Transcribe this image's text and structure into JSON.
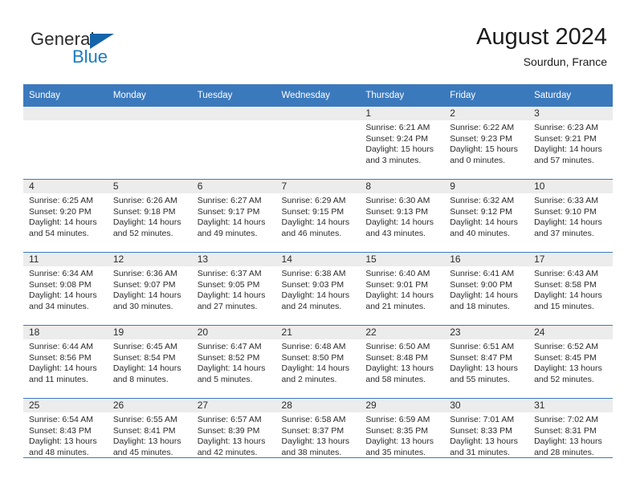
{
  "brand": {
    "name_part1": "General",
    "name_part2": "Blue",
    "triangle_icon": "blue-triangle-icon",
    "accent_color": "#1a7cc4"
  },
  "header": {
    "title": "August 2024",
    "subtitle": "Sourdun, France"
  },
  "theme": {
    "header_blue": "#3b79bd",
    "daynum_band": "#ececec",
    "text": "#2b2b2b"
  },
  "weekdays": [
    "Sunday",
    "Monday",
    "Tuesday",
    "Wednesday",
    "Thursday",
    "Friday",
    "Saturday"
  ],
  "labels": {
    "sunrise": "Sunrise:",
    "sunset": "Sunset:",
    "daylight": "Daylight:"
  },
  "weeks": [
    [
      {
        "blank": true
      },
      {
        "blank": true
      },
      {
        "blank": true
      },
      {
        "blank": true
      },
      {
        "day": "1",
        "sunrise": "Sunrise: 6:21 AM",
        "sunset": "Sunset: 9:24 PM",
        "daylight_line1": "Daylight: 15 hours",
        "daylight_line2": "and 3 minutes."
      },
      {
        "day": "2",
        "sunrise": "Sunrise: 6:22 AM",
        "sunset": "Sunset: 9:23 PM",
        "daylight_line1": "Daylight: 15 hours",
        "daylight_line2": "and 0 minutes."
      },
      {
        "day": "3",
        "sunrise": "Sunrise: 6:23 AM",
        "sunset": "Sunset: 9:21 PM",
        "daylight_line1": "Daylight: 14 hours",
        "daylight_line2": "and 57 minutes."
      }
    ],
    [
      {
        "day": "4",
        "sunrise": "Sunrise: 6:25 AM",
        "sunset": "Sunset: 9:20 PM",
        "daylight_line1": "Daylight: 14 hours",
        "daylight_line2": "and 54 minutes."
      },
      {
        "day": "5",
        "sunrise": "Sunrise: 6:26 AM",
        "sunset": "Sunset: 9:18 PM",
        "daylight_line1": "Daylight: 14 hours",
        "daylight_line2": "and 52 minutes."
      },
      {
        "day": "6",
        "sunrise": "Sunrise: 6:27 AM",
        "sunset": "Sunset: 9:17 PM",
        "daylight_line1": "Daylight: 14 hours",
        "daylight_line2": "and 49 minutes."
      },
      {
        "day": "7",
        "sunrise": "Sunrise: 6:29 AM",
        "sunset": "Sunset: 9:15 PM",
        "daylight_line1": "Daylight: 14 hours",
        "daylight_line2": "and 46 minutes."
      },
      {
        "day": "8",
        "sunrise": "Sunrise: 6:30 AM",
        "sunset": "Sunset: 9:13 PM",
        "daylight_line1": "Daylight: 14 hours",
        "daylight_line2": "and 43 minutes."
      },
      {
        "day": "9",
        "sunrise": "Sunrise: 6:32 AM",
        "sunset": "Sunset: 9:12 PM",
        "daylight_line1": "Daylight: 14 hours",
        "daylight_line2": "and 40 minutes."
      },
      {
        "day": "10",
        "sunrise": "Sunrise: 6:33 AM",
        "sunset": "Sunset: 9:10 PM",
        "daylight_line1": "Daylight: 14 hours",
        "daylight_line2": "and 37 minutes."
      }
    ],
    [
      {
        "day": "11",
        "sunrise": "Sunrise: 6:34 AM",
        "sunset": "Sunset: 9:08 PM",
        "daylight_line1": "Daylight: 14 hours",
        "daylight_line2": "and 34 minutes."
      },
      {
        "day": "12",
        "sunrise": "Sunrise: 6:36 AM",
        "sunset": "Sunset: 9:07 PM",
        "daylight_line1": "Daylight: 14 hours",
        "daylight_line2": "and 30 minutes."
      },
      {
        "day": "13",
        "sunrise": "Sunrise: 6:37 AM",
        "sunset": "Sunset: 9:05 PM",
        "daylight_line1": "Daylight: 14 hours",
        "daylight_line2": "and 27 minutes."
      },
      {
        "day": "14",
        "sunrise": "Sunrise: 6:38 AM",
        "sunset": "Sunset: 9:03 PM",
        "daylight_line1": "Daylight: 14 hours",
        "daylight_line2": "and 24 minutes."
      },
      {
        "day": "15",
        "sunrise": "Sunrise: 6:40 AM",
        "sunset": "Sunset: 9:01 PM",
        "daylight_line1": "Daylight: 14 hours",
        "daylight_line2": "and 21 minutes."
      },
      {
        "day": "16",
        "sunrise": "Sunrise: 6:41 AM",
        "sunset": "Sunset: 9:00 PM",
        "daylight_line1": "Daylight: 14 hours",
        "daylight_line2": "and 18 minutes."
      },
      {
        "day": "17",
        "sunrise": "Sunrise: 6:43 AM",
        "sunset": "Sunset: 8:58 PM",
        "daylight_line1": "Daylight: 14 hours",
        "daylight_line2": "and 15 minutes."
      }
    ],
    [
      {
        "day": "18",
        "sunrise": "Sunrise: 6:44 AM",
        "sunset": "Sunset: 8:56 PM",
        "daylight_line1": "Daylight: 14 hours",
        "daylight_line2": "and 11 minutes."
      },
      {
        "day": "19",
        "sunrise": "Sunrise: 6:45 AM",
        "sunset": "Sunset: 8:54 PM",
        "daylight_line1": "Daylight: 14 hours",
        "daylight_line2": "and 8 minutes."
      },
      {
        "day": "20",
        "sunrise": "Sunrise: 6:47 AM",
        "sunset": "Sunset: 8:52 PM",
        "daylight_line1": "Daylight: 14 hours",
        "daylight_line2": "and 5 minutes."
      },
      {
        "day": "21",
        "sunrise": "Sunrise: 6:48 AM",
        "sunset": "Sunset: 8:50 PM",
        "daylight_line1": "Daylight: 14 hours",
        "daylight_line2": "and 2 minutes."
      },
      {
        "day": "22",
        "sunrise": "Sunrise: 6:50 AM",
        "sunset": "Sunset: 8:48 PM",
        "daylight_line1": "Daylight: 13 hours",
        "daylight_line2": "and 58 minutes."
      },
      {
        "day": "23",
        "sunrise": "Sunrise: 6:51 AM",
        "sunset": "Sunset: 8:47 PM",
        "daylight_line1": "Daylight: 13 hours",
        "daylight_line2": "and 55 minutes."
      },
      {
        "day": "24",
        "sunrise": "Sunrise: 6:52 AM",
        "sunset": "Sunset: 8:45 PM",
        "daylight_line1": "Daylight: 13 hours",
        "daylight_line2": "and 52 minutes."
      }
    ],
    [
      {
        "day": "25",
        "sunrise": "Sunrise: 6:54 AM",
        "sunset": "Sunset: 8:43 PM",
        "daylight_line1": "Daylight: 13 hours",
        "daylight_line2": "and 48 minutes."
      },
      {
        "day": "26",
        "sunrise": "Sunrise: 6:55 AM",
        "sunset": "Sunset: 8:41 PM",
        "daylight_line1": "Daylight: 13 hours",
        "daylight_line2": "and 45 minutes."
      },
      {
        "day": "27",
        "sunrise": "Sunrise: 6:57 AM",
        "sunset": "Sunset: 8:39 PM",
        "daylight_line1": "Daylight: 13 hours",
        "daylight_line2": "and 42 minutes."
      },
      {
        "day": "28",
        "sunrise": "Sunrise: 6:58 AM",
        "sunset": "Sunset: 8:37 PM",
        "daylight_line1": "Daylight: 13 hours",
        "daylight_line2": "and 38 minutes."
      },
      {
        "day": "29",
        "sunrise": "Sunrise: 6:59 AM",
        "sunset": "Sunset: 8:35 PM",
        "daylight_line1": "Daylight: 13 hours",
        "daylight_line2": "and 35 minutes."
      },
      {
        "day": "30",
        "sunrise": "Sunrise: 7:01 AM",
        "sunset": "Sunset: 8:33 PM",
        "daylight_line1": "Daylight: 13 hours",
        "daylight_line2": "and 31 minutes."
      },
      {
        "day": "31",
        "sunrise": "Sunrise: 7:02 AM",
        "sunset": "Sunset: 8:31 PM",
        "daylight_line1": "Daylight: 13 hours",
        "daylight_line2": "and 28 minutes."
      }
    ]
  ]
}
